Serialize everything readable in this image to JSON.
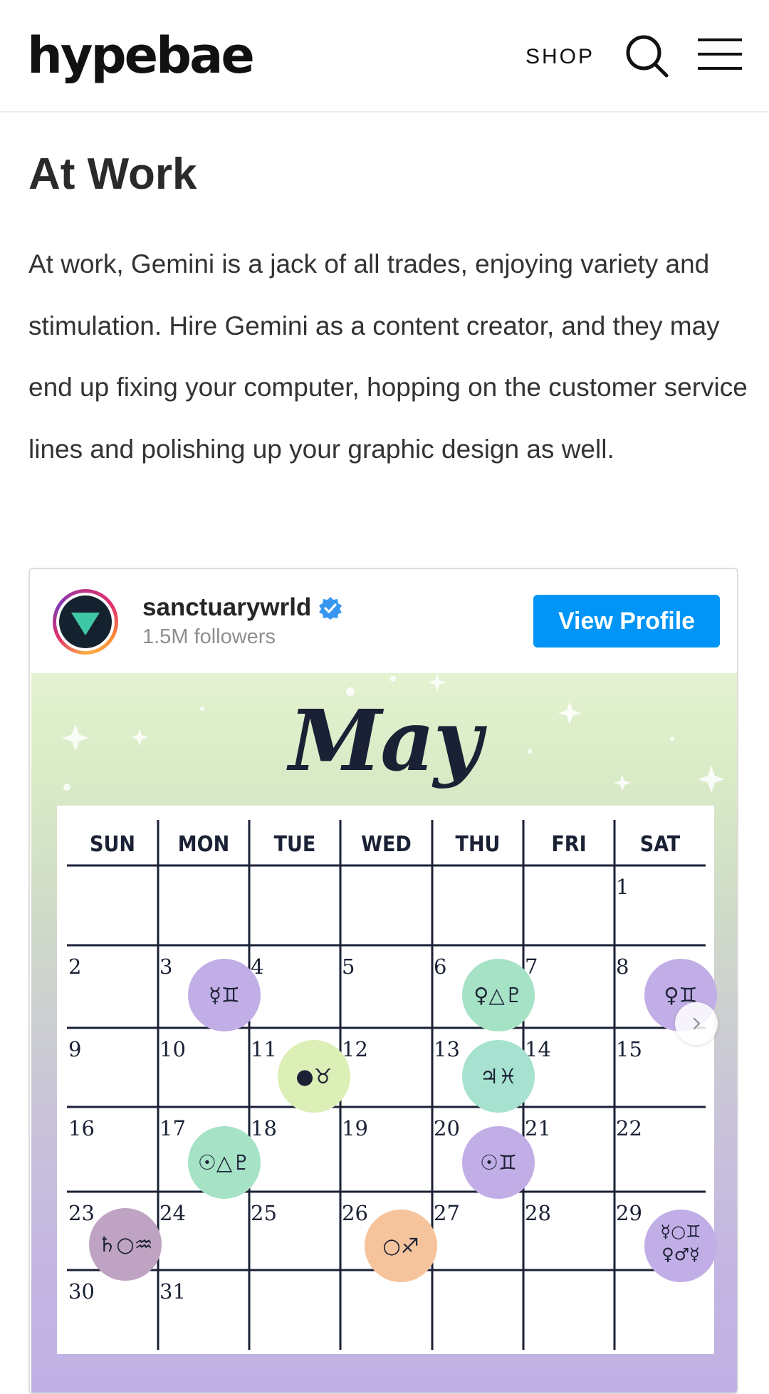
{
  "header": {
    "logo": "hypebae",
    "shop_label": "SHOP",
    "icons": [
      "search-icon",
      "menu-icon"
    ]
  },
  "article": {
    "heading": "At Work",
    "paragraph": "At work, Gemini is a jack of all trades, enjoying variety and stimulation. Hire Gemini as a content creator, and they may end up fixing your computer, hopping on the customer service lines and polishing up your graphic design as well."
  },
  "embed": {
    "username": "sanctuarywrld",
    "followers": "1.5M followers",
    "view_profile_label": "View Profile",
    "post": {
      "month_title": "May",
      "weekdays": [
        "SUN",
        "MON",
        "TUE",
        "WED",
        "THU",
        "FRI",
        "SAT"
      ],
      "weeks": [
        [
          "",
          "",
          "",
          "",
          "",
          "",
          "1"
        ],
        [
          "2",
          "3",
          "4",
          "5",
          "6",
          "7",
          "8"
        ],
        [
          "9",
          "10",
          "11",
          "12",
          "13",
          "14",
          "15"
        ],
        [
          "16",
          "17",
          "18",
          "19",
          "20",
          "21",
          "22"
        ],
        [
          "23",
          "24",
          "25",
          "26",
          "27",
          "28",
          "29"
        ],
        [
          "30",
          "31",
          "",
          "",
          "",
          "",
          ""
        ]
      ],
      "events": [
        {
          "symbols": "☿♊",
          "color": "#c2aee6"
        },
        {
          "symbols": "♀△♇",
          "color": "#a6e2c6"
        },
        {
          "symbols": "♀♊",
          "color": "#c2aee6"
        },
        {
          "symbols": "●♉",
          "color": "#dcefb6"
        },
        {
          "symbols": "♃♓",
          "color": "#a6e2cf"
        },
        {
          "symbols": "☉△♇",
          "color": "#a6e2c6"
        },
        {
          "symbols": "☉♊",
          "color": "#c2aee6"
        },
        {
          "symbols": "♄○♒",
          "color": "#bfa3c2"
        },
        {
          "symbols": "○♐",
          "color": "#f6c49c"
        },
        {
          "symbols": "☿○♊ ♀♂☿",
          "color": "#c2aee6"
        }
      ]
    }
  },
  "colors": {
    "button_blue": "#0095f6",
    "calendar_ink": "#1b2135"
  }
}
